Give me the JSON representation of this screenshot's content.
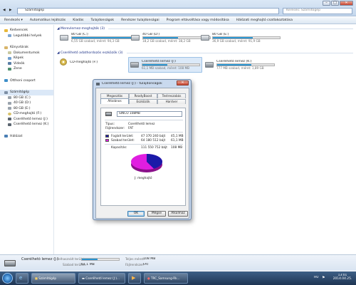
{
  "address": {
    "path": "Számítógép",
    "search_placeholder": "Keresés: Számítógép"
  },
  "commandbar": [
    "Rendezés ▾",
    "Automatikus lejátszás",
    "Kiadás",
    "Tulajdonságok",
    "Rendszer tulajdonságai",
    "Program eltávolítása vagy módosítása",
    "Hálózati meghajtó csatlakoztatása"
  ],
  "nav": {
    "favorites": "Kedvencek",
    "recent": "Legutóbbi helyek",
    "libraries": "Könyvtárak",
    "lib_items": [
      "Dokumentumok",
      "Képek",
      "Videók",
      "Zene"
    ],
    "homegroup": "Otthoni csoport",
    "computer": "Számítógép",
    "drives": [
      "80 GB (C:)",
      "40 GB (D:)",
      "80 GB (E:)",
      "CD-meghajtó (F:)",
      "Cserélhető lemez (J:)",
      "Cserélhető lemez (K:)"
    ],
    "network": "Hálózat"
  },
  "content": {
    "hdd_group": "Merevlemez-meghajtók (3)",
    "hdd": [
      {
        "name": "80 GB (C:)",
        "free": "6,55 GB szabad, méret: 94,3 GB",
        "used": 0.93
      },
      {
        "name": "40 GB (D:)",
        "free": "18,2 GB szabad, méret: 38,2 GB",
        "used": 0.52
      },
      {
        "name": "80 GB (E:)",
        "free": "36,9 GB szabad, méret: 91,9 GB",
        "used": 0.6
      }
    ],
    "removable_group": "Cserélhető adathordozós eszközök (3)",
    "cd": {
      "name": "CD-meghajtó (F:)"
    },
    "removable": [
      {
        "name": "Cserélhető lemez (J:)",
        "free": "61,1 MB szabad, méret: 108 MB",
        "used": 0.44
      },
      {
        "name": "Cserélhető lemez (K:)",
        "free": "777 MB szabad, méret: 1,89 GB",
        "used": 0.6
      }
    ]
  },
  "dialog": {
    "title": "Cserélhető lemez (J:) - tulajdonságok",
    "close_label": "✕",
    "tabs_row1": [
      "Megosztás",
      "ReadyBoost",
      "Testreszabás"
    ],
    "tabs_row2": [
      "Általános",
      "Eszközök",
      "Hardver"
    ],
    "label_value": "SINCO 108MB",
    "type_label": "Típus:",
    "type_value": "Cserélhető lemez",
    "fs_label": "Fájlrendszer:",
    "fs_value": "FAT",
    "used_label": "Foglalt terület:",
    "used_bytes": "47 370 240 bájt",
    "used_size": "45,1 MB",
    "free_label": "Szabad terület:",
    "free_bytes": "64 180 512 bájt",
    "free_size": "61,1 MB",
    "cap_label": "Kapacitás:",
    "cap_bytes": "111 550 752 bájt",
    "cap_size": "108 MB",
    "drive_caption": "J: meghajtó",
    "used_fraction": 0.425,
    "used_color": "#1a1aa8",
    "free_color": "#e01ee0",
    "buttons": {
      "ok": "OK",
      "cancel": "Mégse",
      "apply": "Alkalmaz"
    }
  },
  "details": {
    "name": "Cserélhető lemez (J:)",
    "used_label": "Felhasznált terület:",
    "free_label": "Szabad terület:",
    "free_value": "61,1 MB",
    "total_label": "Teljes méret:",
    "total_value": "108 MB",
    "fs_label": "Fájlrendszer:",
    "fs_value": "FAT",
    "used_fraction": 0.42
  },
  "taskbar": {
    "items": [
      "Számítógép",
      "Cserélhető lemez (J:)...",
      "TRC_Samsung-Rk..."
    ],
    "lang": "HU",
    "time": "13:01",
    "date": "2014.04.25."
  }
}
